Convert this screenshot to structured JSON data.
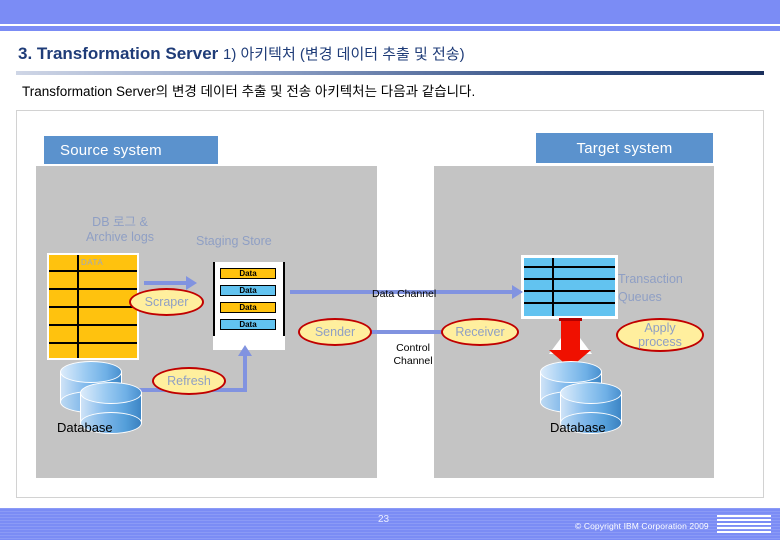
{
  "slide": {
    "title_main": "3. Transformation Server",
    "title_sub": "1) 아키텍처 (변경 데이터 추출 및 전송)",
    "intro": "Transformation Server의 변경 데이터 추출 및 전송 아키텍처는 다음과 같습니다.",
    "accent_title": "#1f3c78",
    "accent_band": "#7b8cf5",
    "accent_header": "#5b92cd"
  },
  "diagram": {
    "source_header": "Source system",
    "target_header": "Target system",
    "labels": {
      "db_logs": "DB 로그 &\nArchive logs",
      "db_logs_line1": "DB 로그 &",
      "db_logs_line2": "Archive logs",
      "staging_store": "Staging Store",
      "transaction_queues_line1": "Transaction",
      "transaction_queues_line2": "Queues",
      "data_channel": "Data Channel",
      "control_channel_line1": "Control",
      "control_channel_line2": "Channel",
      "log_grid_cell": "DATA",
      "database_source": "Database",
      "database_target": "Database"
    },
    "staging_bars": [
      {
        "text": "Data",
        "color": "#ffc20e"
      },
      {
        "text": "Data",
        "color": "#62c3f0"
      },
      {
        "text": "Data",
        "color": "#ffc20e"
      },
      {
        "text": "Data",
        "color": "#62c3f0"
      }
    ],
    "processes": {
      "scraper": "Scraper",
      "refresh": "Refresh",
      "sender": "Sender",
      "receiver": "Receiver",
      "apply_line1": "Apply",
      "apply_line2": "process"
    },
    "colors": {
      "panel_gray": "#c4c4c4",
      "log_orange": "#ffc20e",
      "queue_blue": "#62c3f0",
      "ellipse_fill": "#ffef9e",
      "ellipse_border": "#c00000",
      "arrow_blue": "#8193e0",
      "red_arrow": "#f01000",
      "caption_blue": "#8f9fc4"
    }
  },
  "footer": {
    "page_number": "23",
    "copyright": "© Copyright IBM Corporation 2009",
    "logo": "ibm-logo"
  }
}
